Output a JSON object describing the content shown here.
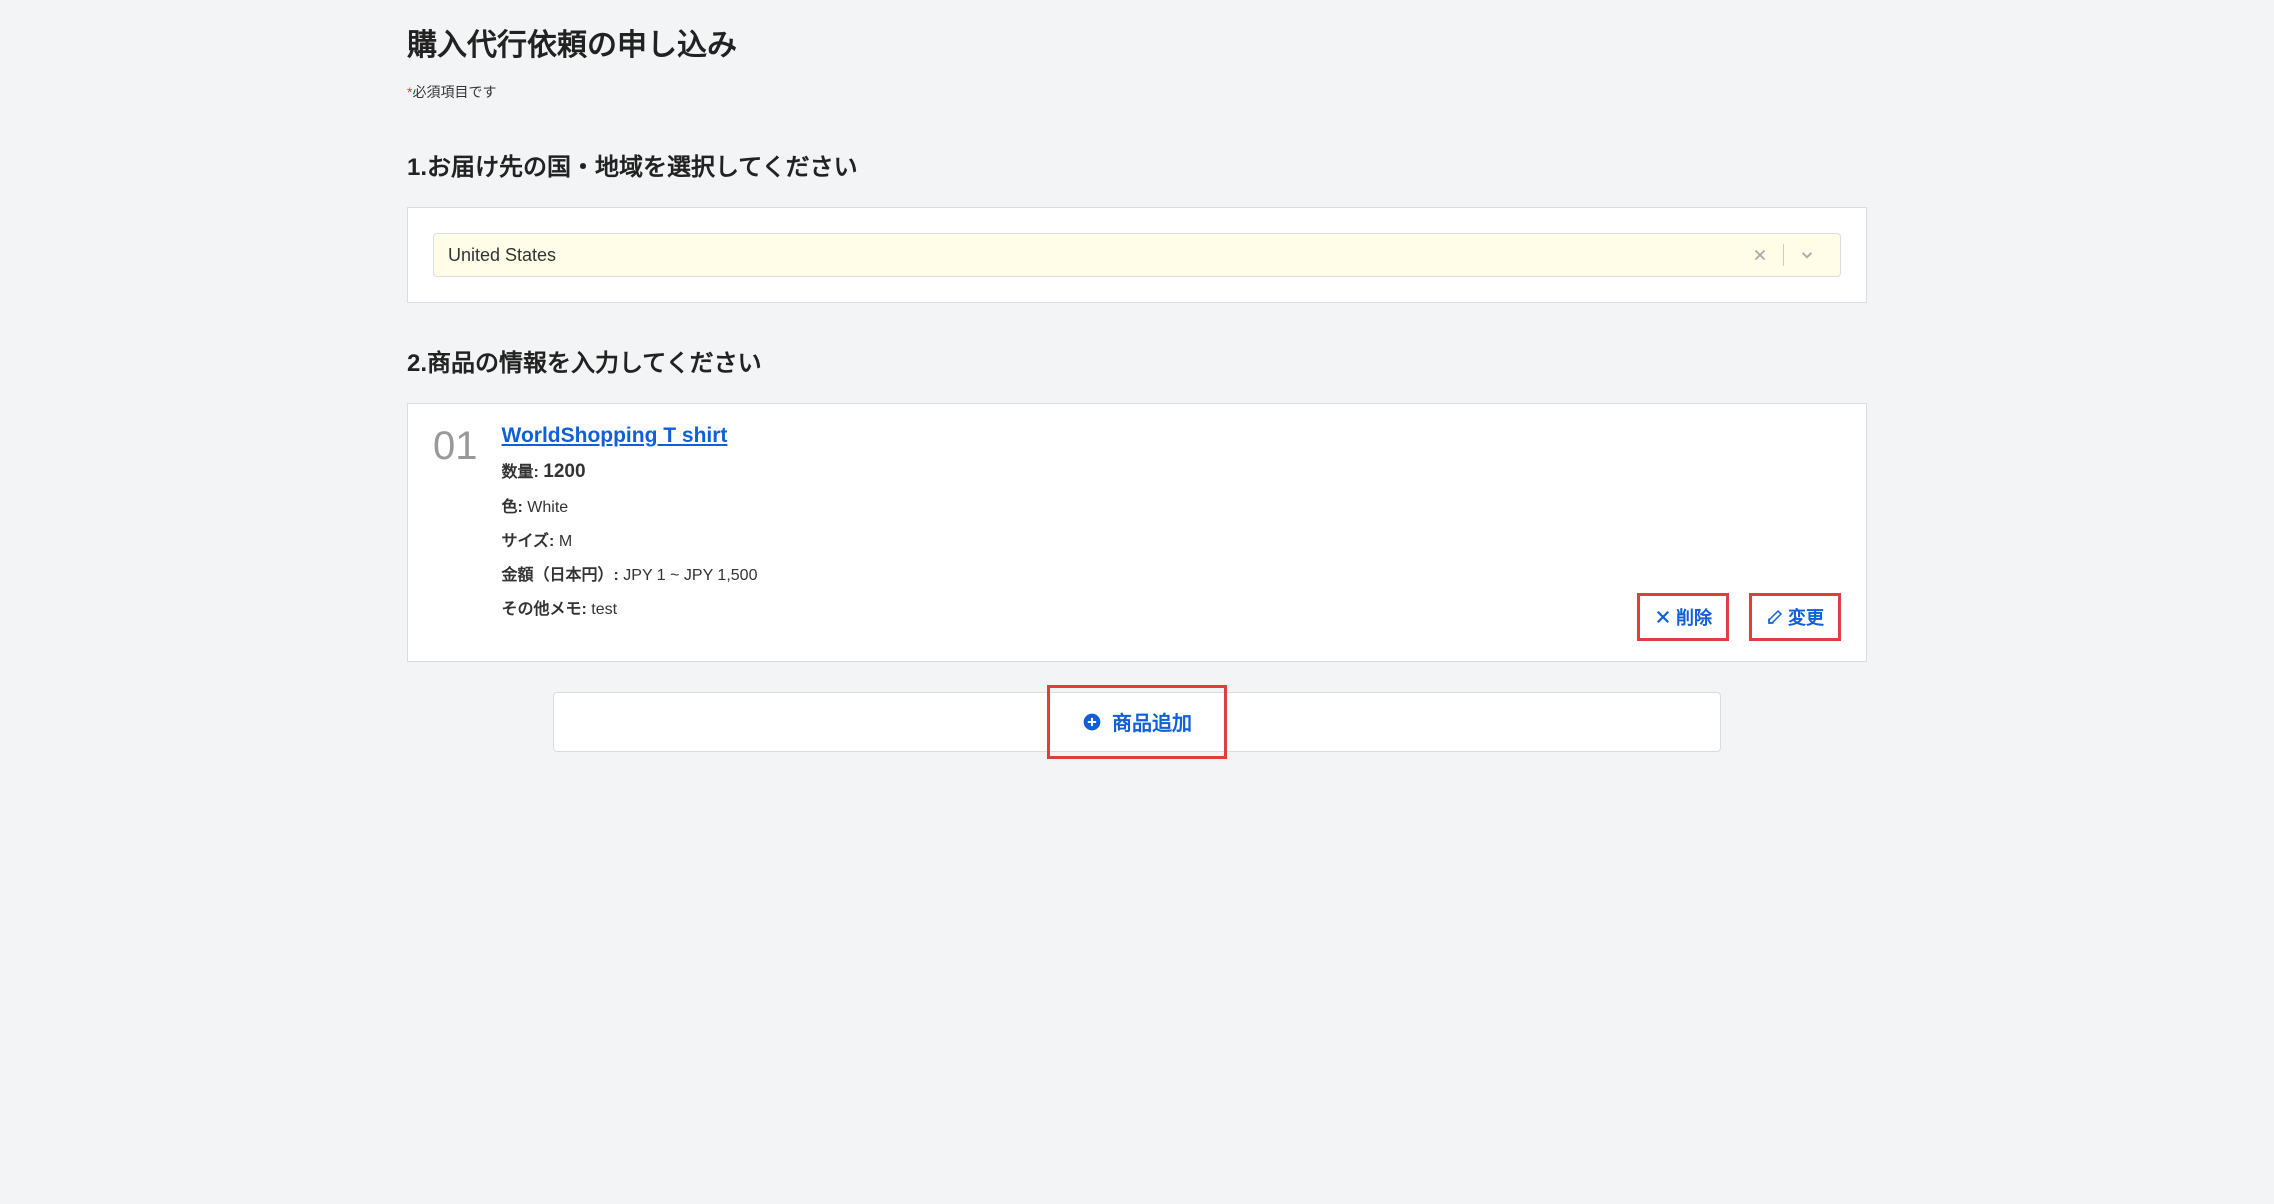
{
  "pageTitle": "購入代行依頼の申し込み",
  "requiredAsterisk": "*",
  "requiredNote": "必須項目です",
  "section1": {
    "heading": "1.お届け先の国・地域を選択してください",
    "selectedCountry": "United States"
  },
  "section2": {
    "heading": "2.商品の情報を入力してください",
    "item": {
      "number": "01",
      "title": "WorldShopping T shirt",
      "qtyLabel": "数量:",
      "qty": "1200",
      "colorLabel": "色:",
      "color": "White",
      "sizeLabel": "サイズ:",
      "size": "M",
      "priceLabel": "金額（日本円）:",
      "price": "JPY 1 ~ JPY 1,500",
      "memoLabel": "その他メモ:",
      "memo": "test"
    },
    "deleteLabel": "削除",
    "editLabel": "変更",
    "addItemLabel": "商品追加"
  }
}
